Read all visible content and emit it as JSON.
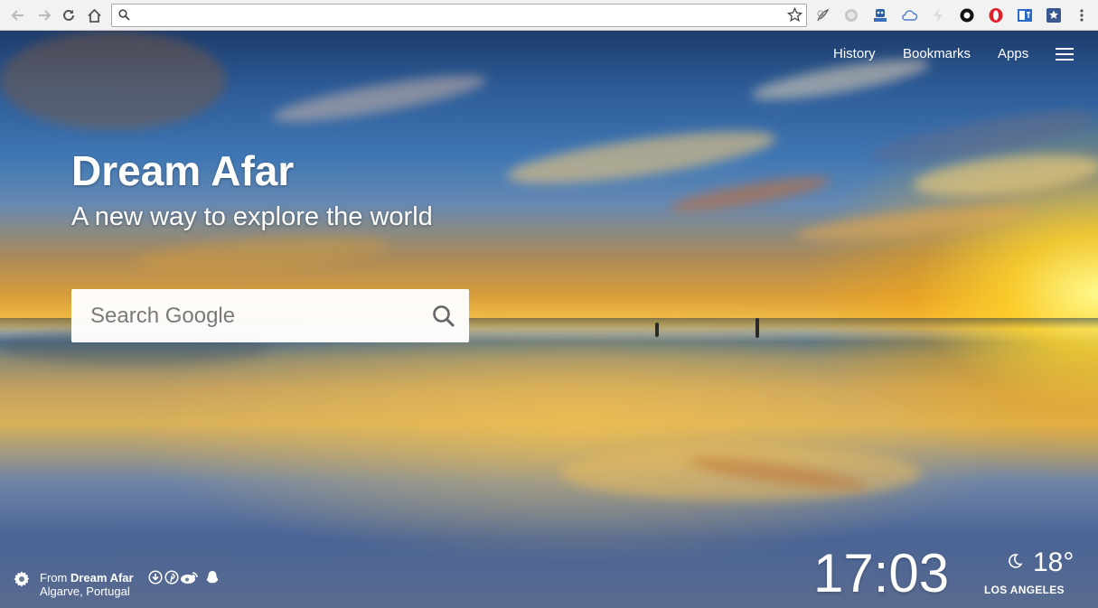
{
  "browser": {
    "address_value": "",
    "icons": {
      "back": "arrow-left-icon",
      "forward": "arrow-right-icon",
      "reload": "reload-icon",
      "home": "home-icon",
      "bookmark": "star-icon",
      "menu": "vertical-dots-icon"
    },
    "extensions": [
      "quill-extension-icon",
      "gray-circle-extension-icon",
      "robot-extension-icon",
      "cloud-extension-icon",
      "lightning-extension-icon",
      "black-circle-extension-icon",
      "opera-extension-icon",
      "translate-extension-icon",
      "star-box-extension-icon"
    ]
  },
  "nav": {
    "history": "History",
    "bookmarks": "Bookmarks",
    "apps": "Apps"
  },
  "hero": {
    "title": "Dream Afar",
    "subtitle": "A new way to explore the world"
  },
  "search": {
    "placeholder": "Search Google"
  },
  "credit": {
    "from": "From",
    "source": "Dream Afar",
    "location": "Algarve, Portugal"
  },
  "clock": {
    "time": "17:03"
  },
  "weather": {
    "temperature": "18°",
    "city": "LOS ANGELES",
    "condition_icon": "moon-icon"
  },
  "colors": {
    "toolbar_bg": "#f2f2f2",
    "text_on_image": "#ffffff"
  }
}
